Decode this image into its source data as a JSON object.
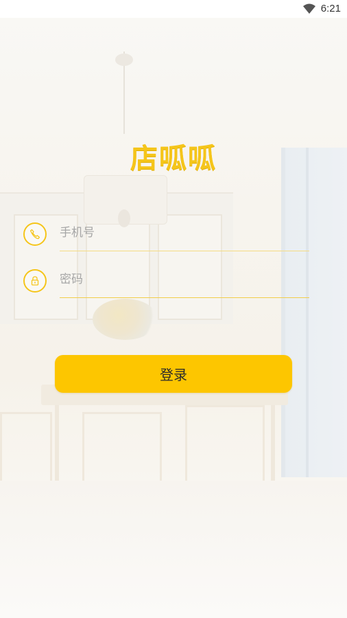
{
  "status_bar": {
    "time": "6:21",
    "icons": [
      "wifi-icon"
    ]
  },
  "app": {
    "logo_text": "店呱呱"
  },
  "form": {
    "phone": {
      "icon": "phone-icon",
      "placeholder": "手机号",
      "value": ""
    },
    "password": {
      "icon": "lock-icon",
      "placeholder": "密码",
      "value": ""
    },
    "submit_label": "登录"
  },
  "colors": {
    "accent": "#f5c51a",
    "button": "#fdc600"
  }
}
